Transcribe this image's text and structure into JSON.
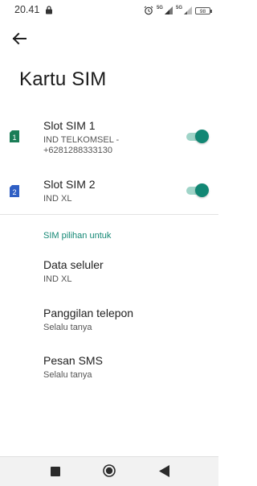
{
  "status_bar": {
    "time": "20.41",
    "net1": "5G",
    "net2": "5G",
    "battery": "98"
  },
  "page": {
    "title": "Kartu SIM"
  },
  "sims": [
    {
      "slot_number": "1",
      "title": "Slot SIM 1",
      "subtitle_line1": "IND TELKOMSEL -",
      "subtitle_line2": "+6281288333130",
      "enabled": true,
      "icon_color": "#1b7d57"
    },
    {
      "slot_number": "2",
      "title": "Slot SIM 2",
      "subtitle_line1": "IND XL",
      "enabled": true,
      "icon_color": "#2f5fc4"
    }
  ],
  "preferred_sim": {
    "header": "SIM pilihan untuk",
    "items": [
      {
        "title": "Data seluler",
        "value": "IND XL"
      },
      {
        "title": "Panggilan telepon",
        "value": "Selalu tanya"
      },
      {
        "title": "Pesan SMS",
        "value": "Selalu tanya"
      }
    ]
  },
  "colors": {
    "accent": "#128774",
    "toggle_track": "#9fd4c8"
  },
  "icons": {
    "lock": "lock-icon",
    "alarm": "alarm-icon",
    "signal": "signal-icon",
    "back": "arrow-left-icon",
    "sim": "sim-card-icon",
    "recents": "square-icon",
    "home": "circle-icon",
    "nav_back": "triangle-left-icon"
  }
}
